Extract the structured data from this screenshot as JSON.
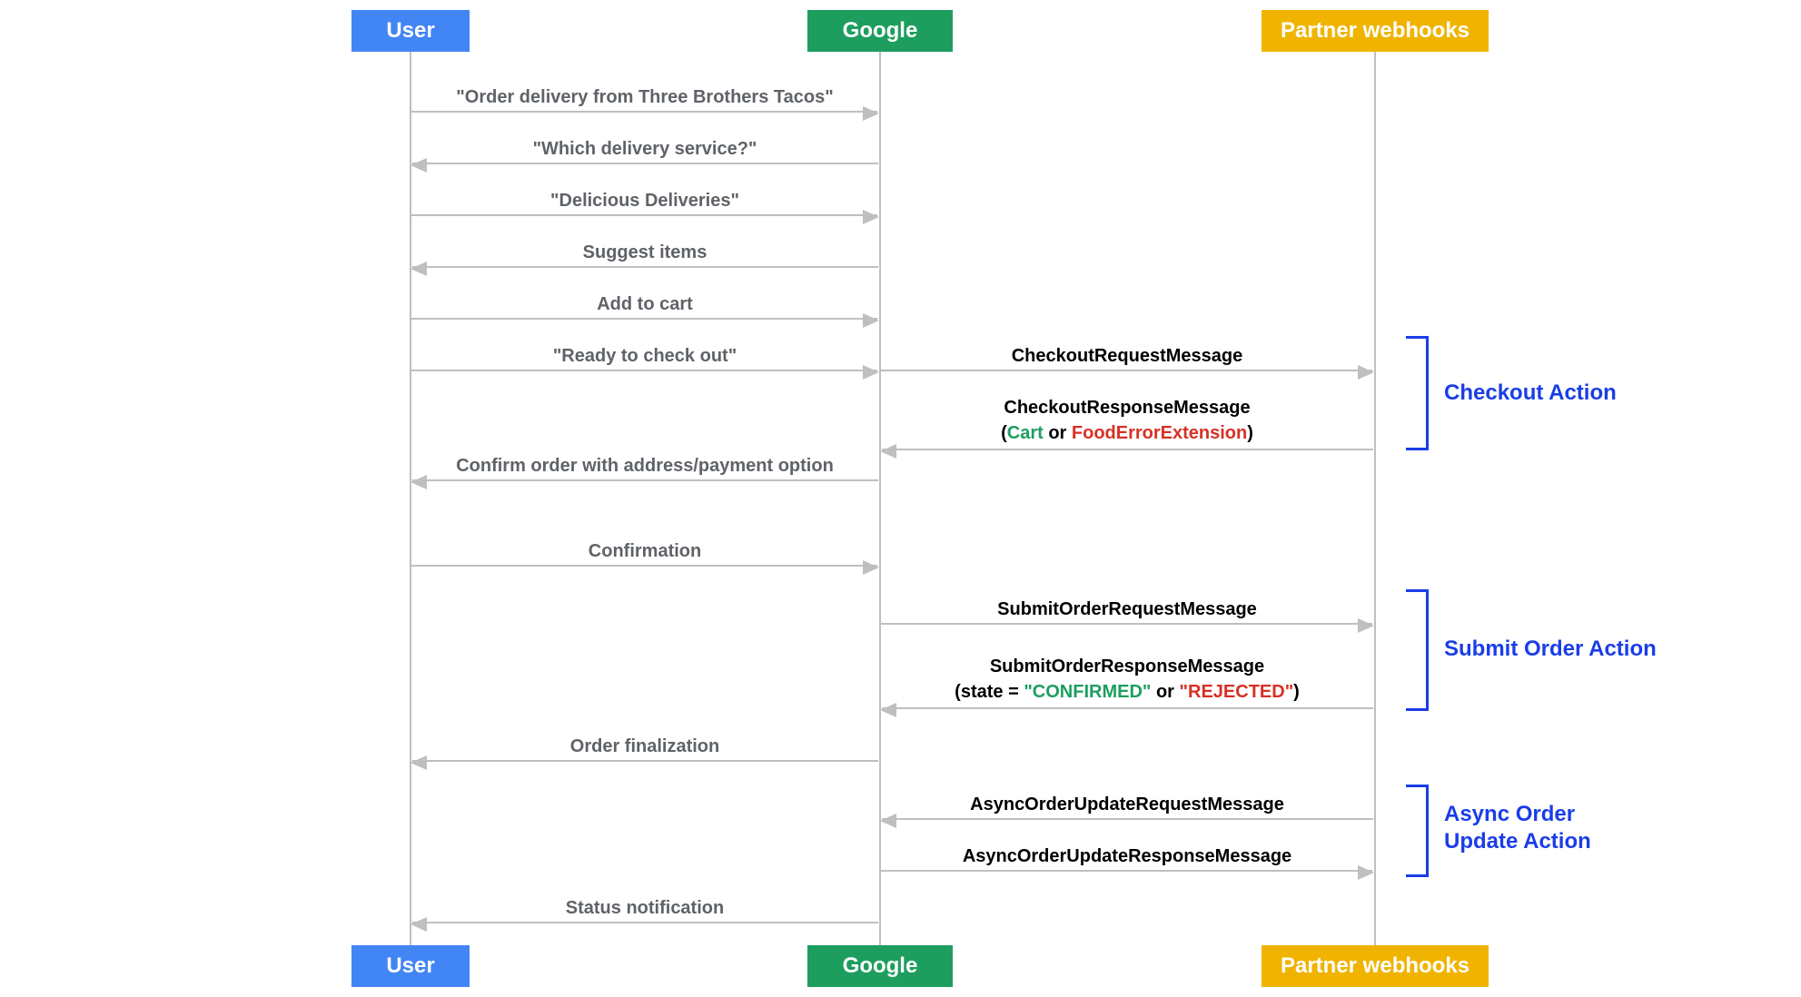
{
  "participants": {
    "user": "User",
    "google": "Google",
    "partner": "Partner webhooks"
  },
  "left_messages": {
    "m1": "\"Order delivery from Three Brothers Tacos\"",
    "m2": "\"Which delivery service?\"",
    "m3": "\"Delicious Deliveries\"",
    "m4": "Suggest items",
    "m5": "Add to cart",
    "m6": "\"Ready to check out\"",
    "m7": "Confirm order with address/payment option",
    "m8": "Confirmation",
    "m9": "Order finalization",
    "m10": "Status notification"
  },
  "right_messages": {
    "r1": "CheckoutRequestMessage",
    "r2": "CheckoutResponseMessage",
    "r2sub_open": "(",
    "r2sub_cart": "Cart",
    "r2sub_or": " or ",
    "r2sub_err": "FoodErrorExtension",
    "r2sub_close": ")",
    "r3": "SubmitOrderRequestMessage",
    "r4": "SubmitOrderResponseMessage",
    "r4sub_open": "(state = ",
    "r4sub_conf": "\"CONFIRMED\"",
    "r4sub_or": " or ",
    "r4sub_rej": "\"REJECTED\"",
    "r4sub_close": ")",
    "r5": "AsyncOrderUpdateRequestMessage",
    "r6": "AsyncOrderUpdateResponseMessage"
  },
  "brackets": {
    "b1": "Checkout Action",
    "b2": "Submit Order Action",
    "b3": "Async Order Update Action"
  },
  "chart_data": {
    "type": "sequence-diagram",
    "participants": [
      "User",
      "Google",
      "Partner webhooks"
    ],
    "messages": [
      {
        "from": "User",
        "to": "Google",
        "text": "\"Order delivery from Three Brothers Tacos\""
      },
      {
        "from": "Google",
        "to": "User",
        "text": "\"Which delivery service?\""
      },
      {
        "from": "User",
        "to": "Google",
        "text": "\"Delicious Deliveries\""
      },
      {
        "from": "Google",
        "to": "User",
        "text": "Suggest items"
      },
      {
        "from": "User",
        "to": "Google",
        "text": "Add to cart"
      },
      {
        "from": "User",
        "to": "Google",
        "text": "\"Ready to check out\""
      },
      {
        "from": "Google",
        "to": "Partner webhooks",
        "text": "CheckoutRequestMessage",
        "group": "Checkout Action"
      },
      {
        "from": "Partner webhooks",
        "to": "Google",
        "text": "CheckoutResponseMessage",
        "note": "(Cart or FoodErrorExtension)",
        "group": "Checkout Action"
      },
      {
        "from": "Google",
        "to": "User",
        "text": "Confirm order with address/payment option"
      },
      {
        "from": "User",
        "to": "Google",
        "text": "Confirmation"
      },
      {
        "from": "Google",
        "to": "Partner webhooks",
        "text": "SubmitOrderRequestMessage",
        "group": "Submit Order Action"
      },
      {
        "from": "Partner webhooks",
        "to": "Google",
        "text": "SubmitOrderResponseMessage",
        "note": "(state = \"CONFIRMED\" or \"REJECTED\")",
        "group": "Submit Order Action"
      },
      {
        "from": "Google",
        "to": "User",
        "text": "Order finalization"
      },
      {
        "from": "Partner webhooks",
        "to": "Google",
        "text": "AsyncOrderUpdateRequestMessage",
        "group": "Async Order Update Action"
      },
      {
        "from": "Google",
        "to": "Partner webhooks",
        "text": "AsyncOrderUpdateResponseMessage",
        "group": "Async Order Update Action"
      },
      {
        "from": "Google",
        "to": "User",
        "text": "Status notification"
      }
    ]
  }
}
